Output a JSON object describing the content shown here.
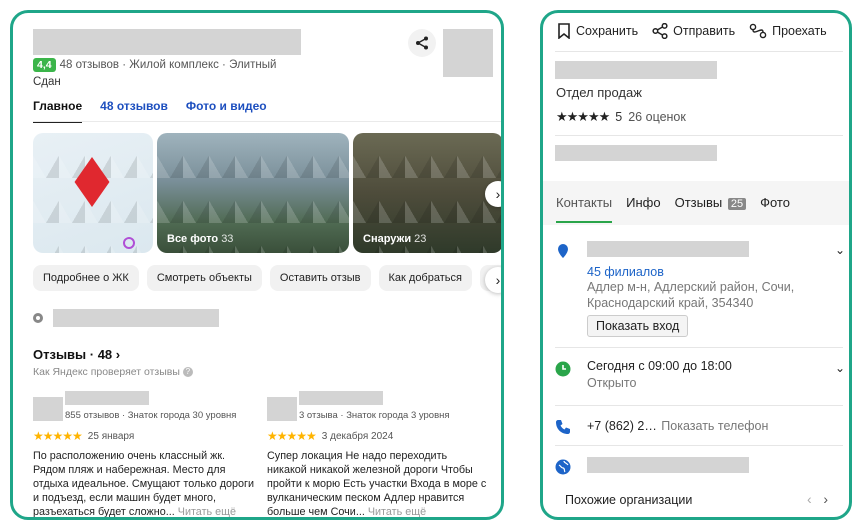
{
  "left": {
    "rating": "4,4",
    "meta_text": "48 отзывов · Жилой комплекс · Элитный",
    "status": "Сдан",
    "tabs": [
      "Главное",
      "48 отзывов",
      "Фото и видео"
    ],
    "gallery": {
      "all_photos_label": "Все фото",
      "all_photos_count": "33",
      "outside_label": "Снаружи",
      "outside_count": "23"
    },
    "chips": [
      "Подробнее о ЖК",
      "Смотреть объекты",
      "Оставить отзыв",
      "Как добраться",
      "П"
    ],
    "reviews_heading": "Отзывы · 48",
    "reviews_subtitle": "Как Яндекс проверяет отзывы",
    "reviews": [
      {
        "author_info": "855 отзывов · Знаток города 30 уровня",
        "stars": "★★★★★",
        "date": "25 января",
        "text": "По расположению очень классный жк. Рядом пляж и набережная. Место для отдыха идеальное. Смущают только дороги и подъезд, если машин будет много, разъехаться будет сложно...",
        "more": "Читать ещё"
      },
      {
        "author_info": "3 отзыва · Знаток города 3 уровня",
        "stars": "★★★★★",
        "date": "3 декабря 2024",
        "text": "Супер локация Не надо переходить никакой никакой железной дороги Чтобы пройти к морю Есть участки Входа в море с вулканическим песком Адлер нравится больше чем Сочи...",
        "more": "Читать ещё"
      }
    ]
  },
  "right": {
    "actions": [
      "Сохранить",
      "Отправить",
      "Проехать"
    ],
    "department": "Отдел продаж",
    "stars": "★★★★★",
    "rating_value": "5",
    "rating_count": "26 оценок",
    "tabs": [
      "Контакты",
      "Инфо",
      "Отзывы",
      "Фото"
    ],
    "reviews_badge": "25",
    "branches_link": "45 филиалов",
    "address": "Адлер м-н, Адлерский район, Сочи, Краснодарский край, 354340",
    "show_entrance": "Показать вход",
    "hours": "Сегодня с 09:00 до 18:00",
    "open_status": "Открыто",
    "phone": "+7 (862) 2…",
    "show_phone": "Показать телефон",
    "similar": "Похожие организации"
  },
  "colors": {
    "accent_border": "#1fa689",
    "rating_green": "#3bb54a",
    "link_blue": "#1d4fbf",
    "star_yellow": "#ffb400"
  }
}
